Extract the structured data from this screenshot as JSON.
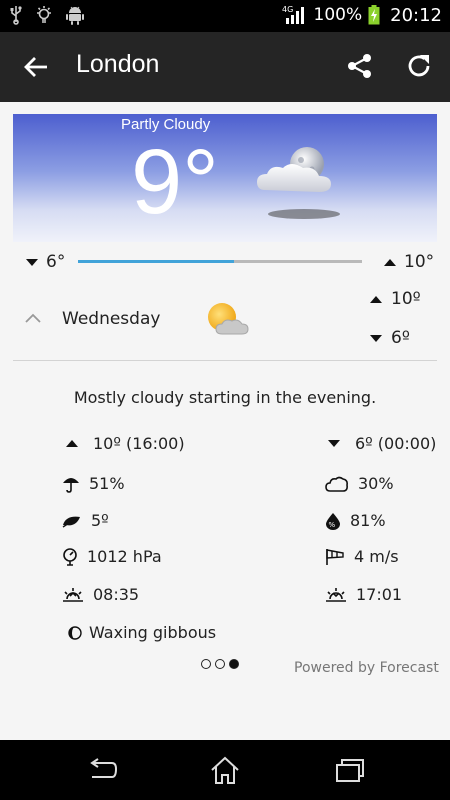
{
  "status_bar": {
    "network": "4G",
    "battery": "100%",
    "time": "20:12"
  },
  "action_bar": {
    "title": "London"
  },
  "current": {
    "condition": "Partly Cloudy",
    "temperature": "9°",
    "icon": "partly-cloudy-night-icon"
  },
  "range": {
    "low": "6°",
    "high": "10°",
    "current_fraction": 0.55
  },
  "day": {
    "name": "Wednesday",
    "high": "10º",
    "low": "6º",
    "icon": "sun-behind-cloud-icon"
  },
  "summary": "Mostly cloudy starting in the evening.",
  "details": {
    "max": "10º (16:00)",
    "min": "6º (00:00)",
    "precipitation": "51%",
    "cloud_cover": "30%",
    "dew_point": "5º",
    "humidity": "81%",
    "pressure": "1012 hPa",
    "wind": "4 m/s",
    "sunrise": "08:35",
    "sunset": "17:01",
    "moon_phase": "Waxing gibbous"
  },
  "pager": {
    "pages": 3,
    "active": 3
  },
  "powered_by": "Powered by Forecast",
  "colors": {
    "accent": "#41a3d9",
    "action_bar": "#252525"
  }
}
